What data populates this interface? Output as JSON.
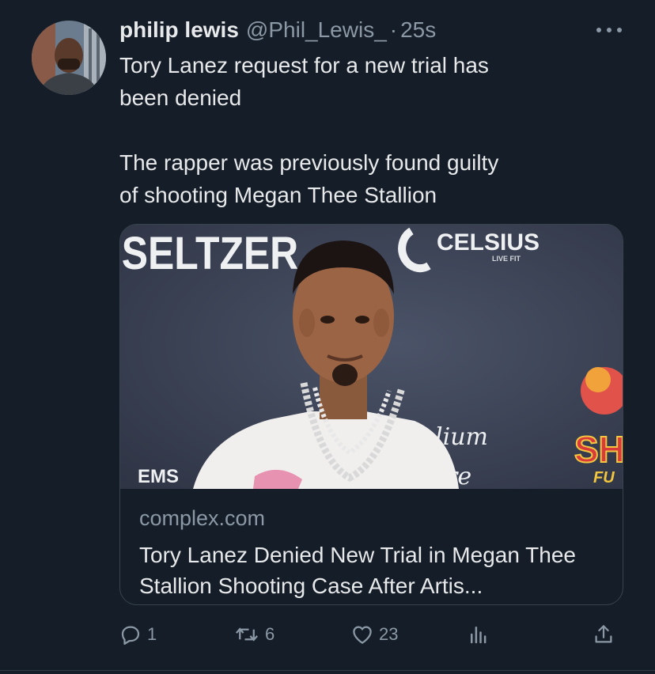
{
  "author": {
    "display_name": "philip lewis",
    "handle": "@Phil_Lewis_",
    "separator": "·",
    "time": "25s"
  },
  "tweet": {
    "text": "Tory Lanez request for a new trial has\nbeen denied\n\nThe rapper was previously found guilty\nof shooting Megan Thee Stallion"
  },
  "card": {
    "image_text": {
      "brand_left": "SELTZER",
      "brand_right": "CELSIUS",
      "brand_right_sub": "LIVE FIT",
      "lower_left": "EMS",
      "script_text": "lium",
      "script_text_2": "re",
      "right_text": "SH",
      "right_text_sub": "FU"
    },
    "domain": "complex.com",
    "title": "Tory Lanez Denied New Trial in Megan Thee Stallion Shooting Case After Artis..."
  },
  "actions": {
    "reply_count": "1",
    "retweet_count": "6",
    "like_count": "23"
  },
  "colors": {
    "background": "#151d28",
    "text": "#e7e9ea",
    "muted": "#8b98a5",
    "border": "#38444d"
  }
}
